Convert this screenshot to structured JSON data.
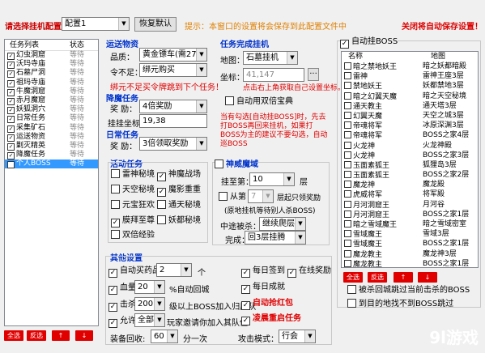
{
  "header": {
    "config_label": "请选择挂机配置：",
    "config_value": "配置1",
    "restore_btn": "恢复默认",
    "tip": "提示：本窗口的设置将会保存到此配置文件中",
    "auto_save": "关闭将自动保存设置！"
  },
  "task_list": {
    "col_name": "任务列表",
    "col_status": "状态",
    "items": [
      {
        "name": "幻虫洞窟",
        "status": "等待"
      },
      {
        "name": "沃玛寺庙",
        "status": "等待"
      },
      {
        "name": "石墓尸洞",
        "status": "等待"
      },
      {
        "name": "祖玛寺庙",
        "status": "等待"
      },
      {
        "name": "牛魔洞窟",
        "status": "等待"
      },
      {
        "name": "赤月魔窟",
        "status": "等待"
      },
      {
        "name": "妖狐洞穴",
        "status": "等待"
      },
      {
        "name": "日常任务",
        "status": "等待"
      },
      {
        "name": "采集矿石",
        "status": "等待"
      },
      {
        "name": "运送物资",
        "status": "等待"
      },
      {
        "name": "剿灭精英",
        "status": "等待"
      },
      {
        "name": "降魔任务",
        "status": "等待"
      },
      {
        "name": "个人BOSS",
        "status": "等待"
      }
    ]
  },
  "transport": {
    "title": "运送物资",
    "item_lbl": "品质：",
    "item_val": "黄金镖车(需27个",
    "token_lbl": "令不足：",
    "token_val": "绑元购买",
    "warn": "绑元不足买令牌跳到下个任务！"
  },
  "demon": {
    "title": "降魔任务",
    "reward_lbl": "奖   励：",
    "reward_val": "4倍奖励",
    "coord_lbl": "挂挂坐标：",
    "coord_val": "19,38"
  },
  "daily": {
    "title": "日常任务",
    "reward_lbl": "奖   励：",
    "reward_val": "3倍领取奖励"
  },
  "complete": {
    "title": "任务完成挂机",
    "map_lbl": "地图：",
    "map_val": "石墓挂机",
    "coord_lbl": "坐标：",
    "coord_val": "41,147",
    "coord_btn": "···",
    "coord_tip": "点击右上角获取自己设置坐标。",
    "auto_book": "自动用双倍宝典",
    "note": "当有勾选[自动挂BOSS]时，先去打BOSS再回来挂机，如果打BOSS为主的建议不要勾选，自动巡BOSS"
  },
  "activity": {
    "title": "活动任务",
    "items": [
      "雷神秘境",
      "神魔战场",
      "天空秘境",
      "魔影重重",
      "元宝狂欢",
      "通天秘境",
      "膜拜至尊",
      "妖都秘境",
      "双倍经验"
    ],
    "checked": [
      false,
      true,
      false,
      true,
      false,
      false,
      true,
      false,
      false
    ]
  },
  "tower": {
    "title": "神威魔域",
    "floor_lbl": "挂至第：",
    "floor_val": "10",
    "floor_unit": "层",
    "from_lbl": "从第",
    "from_val": "7",
    "from_tail": "层起只领奖励",
    "note": "(原地挂机等待别人杀BOSS)",
    "escape_lbl": "中途被杀：",
    "escape_val": "继续爬层",
    "done_lbl": "完成：",
    "done_val": "回3层挂腾"
  },
  "other": {
    "title": "其他设置",
    "auto_buy": "自动买药品",
    "auto_buy_val": "2",
    "auto_buy_unit": "个",
    "hp": "血量",
    "hp_val": "20",
    "hp_unit": "%自动回城",
    "kill": "击杀",
    "kill_val": "200",
    "kill_unit": "级以上BOSS加入归属队",
    "allow": "允许",
    "allow_val": "全部",
    "allow_unit": "玩家邀请你加入其队伍",
    "equip": "装备回收:",
    "equip_val": "60",
    "equip_unit": "分一次",
    "sign": "每日签到",
    "online": "在线奖励",
    "achieve": "每日成就",
    "redpack": "自动抢红包",
    "restart": "凌晨重启任务",
    "attack_lbl": "攻击模式：",
    "attack_val": "行会"
  },
  "boss": {
    "title": "自动挂BOSS",
    "col_name": "名称",
    "col_map": "地图",
    "items": [
      [
        "暗之禁地妖王",
        "暗之妖都暗殿"
      ],
      [
        "雷神",
        "雷神王座3层"
      ],
      [
        "禁地妖王",
        "妖都禁地3层"
      ],
      [
        "暗之幻翼天魔",
        "暗之天空秘境"
      ],
      [
        "通天教主",
        "通天塔3层"
      ],
      [
        "幻翼天魔",
        "天空之城3层"
      ],
      [
        "帝魂将军",
        "冰原深渊3层"
      ],
      [
        "帝魂将军",
        "BOSS之家4层"
      ],
      [
        "火龙神",
        "火龙神殿"
      ],
      [
        "火龙神",
        "BOSS之家3层"
      ],
      [
        "玉面素狐王",
        "狐狸岛3层"
      ],
      [
        "玉面素狐王",
        "BOSS之家2层"
      ],
      [
        "魔龙神",
        "魔龙殿"
      ],
      [
        "虎威将军",
        "将军殿"
      ],
      [
        "月河洞窟王",
        "月河谷"
      ],
      [
        "月河洞窟王",
        "BOSS之家1层"
      ],
      [
        "暗之雪域魔王",
        "暗之雪域密室"
      ],
      [
        "雪域魔王",
        "雪域3层"
      ],
      [
        "雪域魔王",
        "BOSS之家1层"
      ],
      [
        "魔龙教主",
        "魔龙神3层"
      ],
      [
        "魔龙教主",
        "BOSS之家1层"
      ]
    ],
    "note1": "被杀回城跳过当前击杀的BOSS",
    "note2": "到目的地找不到BOSS跳过"
  },
  "buttons": {
    "select_all": "全选",
    "invert": "反选",
    "up": "↑",
    "down": "↓"
  },
  "watermark": "9l游戏"
}
